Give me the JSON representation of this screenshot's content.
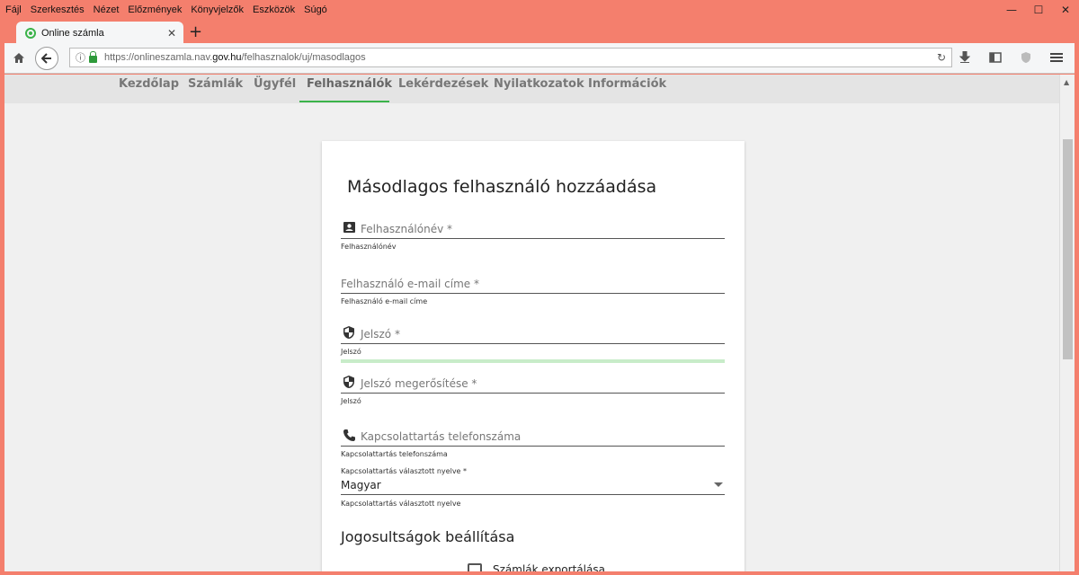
{
  "menu": [
    "Fájl",
    "Szerkesztés",
    "Nézet",
    "Előzmények",
    "Könyvjelzők",
    "Eszközök",
    "Súgó"
  ],
  "window_controls": {
    "minimize": "—",
    "maximize": "☐",
    "close": "✕"
  },
  "tab": {
    "title": "Online számla",
    "close": "✕",
    "new_tab": "+"
  },
  "address": {
    "url_prefix": "https://onlineszamla.nav.",
    "url_domain": "gov.hu",
    "url_path": "/felhasznalok/uj/masodlagos"
  },
  "site_nav": {
    "items": [
      "Kezdőlap",
      "Számlák",
      "Ügyfél",
      "Felhasználók",
      "Lekérdezések",
      "Nyilatkozatok",
      "Információk"
    ],
    "active": "Felhasználók"
  },
  "form": {
    "title": "Másodlagos felhasználó hozzáadása",
    "username": {
      "label": "Felhasználónév *",
      "hint": "Felhasználónév"
    },
    "email": {
      "label": "Felhasználó e-mail címe *",
      "hint": "Felhasználó e-mail címe"
    },
    "password": {
      "label": "Jelszó *",
      "hint": "Jelszó"
    },
    "password_confirm": {
      "label": "Jelszó megerősítése *",
      "hint": "Jelszó"
    },
    "phone": {
      "label": "Kapcsolattartás telefonszáma",
      "hint": "Kapcsolattartás telefonszáma"
    },
    "language": {
      "label": "Kapcsolattartás választott nyelve *",
      "value": "Magyar",
      "hint": "Kapcsolattartás választott nyelve"
    },
    "permissions_title": "Jogosultságok beállítása",
    "first_permission": "Számlák exportálása"
  },
  "colors": {
    "accent": "#3bb34a",
    "frame": "#f47f6d"
  }
}
